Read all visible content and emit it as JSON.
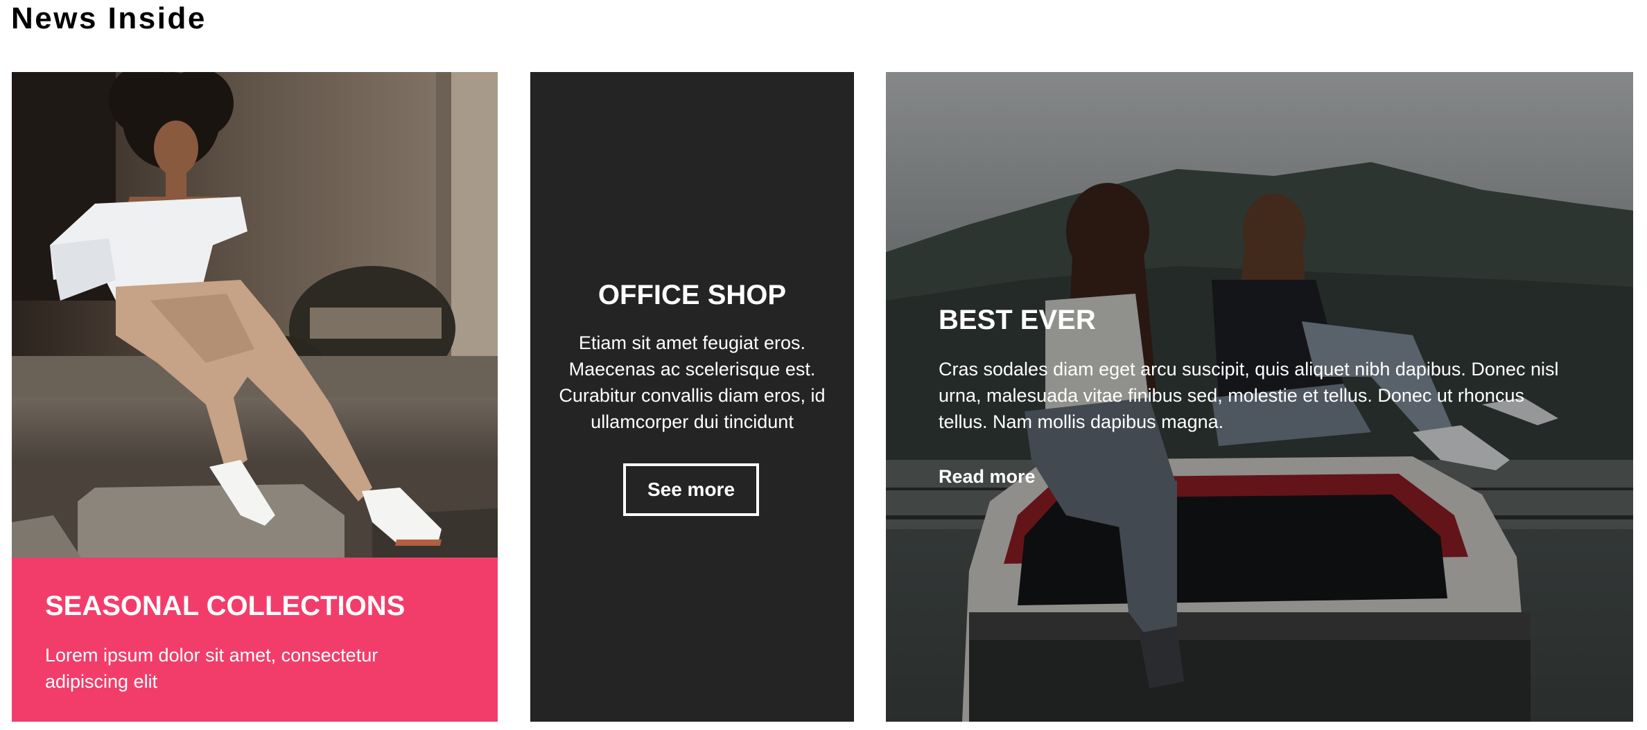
{
  "page": {
    "title": "News Inside"
  },
  "cards": {
    "seasonal": {
      "title": "SEASONAL COLLECTIONS",
      "text": "Lorem ipsum dolor sit amet, consectetur adipiscing elit",
      "accent_color": "#f23d6b",
      "image": "woman-sitting-on-steps-photo"
    },
    "office": {
      "title": "OFFICE SHOP",
      "text": "Etiam sit amet feugiat eros. Maecenas ac scelerisque est. Curabitur convallis diam eros, id ullamcorper dui tincidunt",
      "button_label": "See more",
      "background_color": "#242424"
    },
    "best": {
      "title": "BEST EVER",
      "text": "Cras sodales diam eget arcu suscipit, quis aliquet nibh dapibus. Donec nisl urna, malesuada vitae finibus sed, molestie et tellus. Donec ut rhoncus tellus. Nam mollis dapibus magna.",
      "link_label": "Read more",
      "image": "two-women-sitting-on-car-roof-photo"
    }
  }
}
